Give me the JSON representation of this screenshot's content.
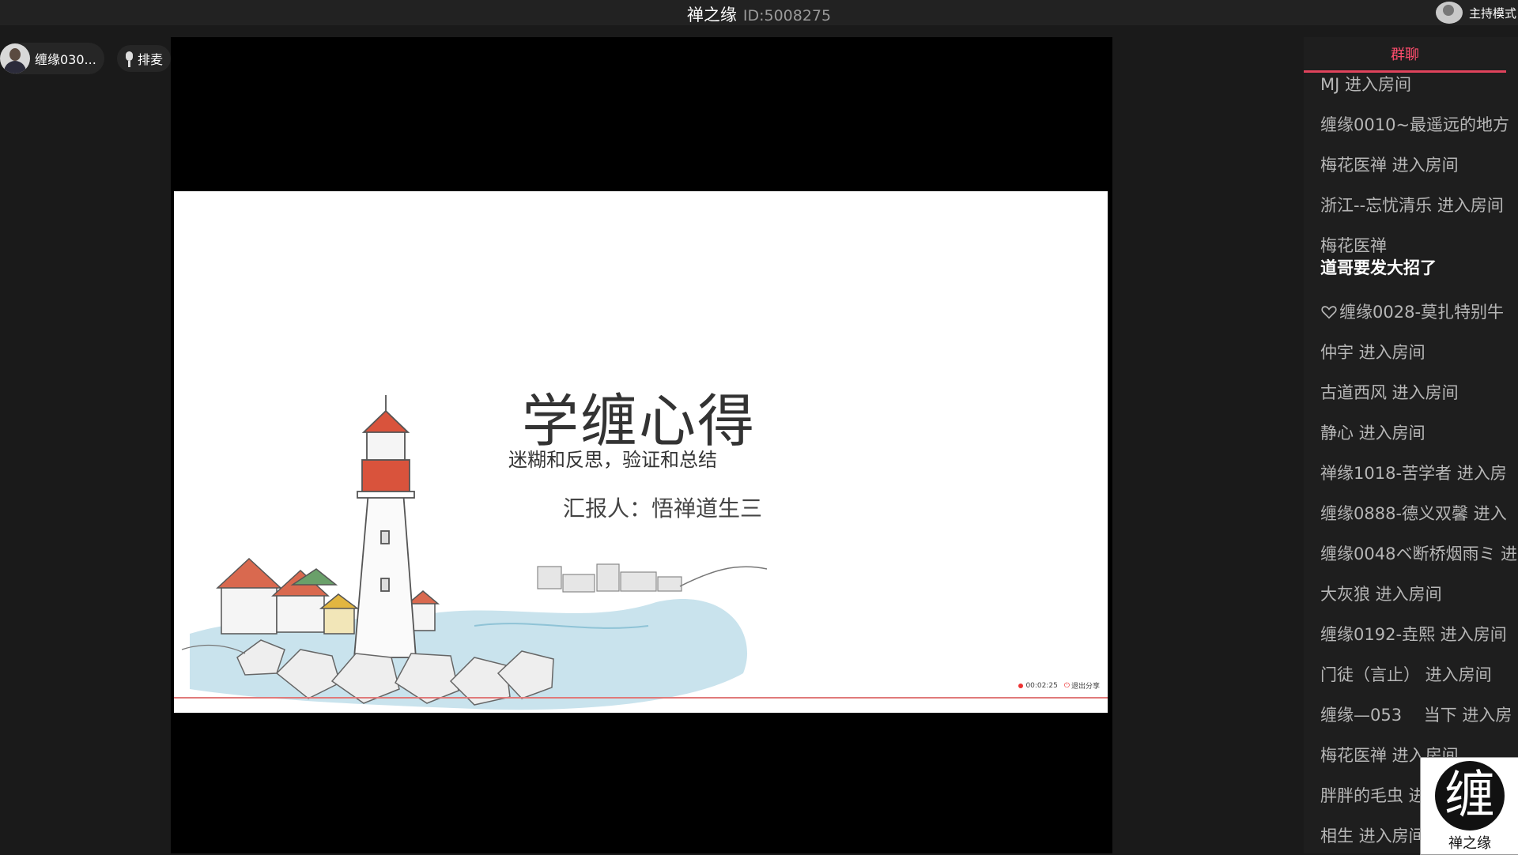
{
  "header": {
    "room_name": "禅之缘",
    "room_id": "ID:5008275",
    "host_mode_label": "主持模式"
  },
  "participants": {
    "user_name": "缠缘030...",
    "queue_label": "排麦"
  },
  "slide": {
    "title": "学缠心得",
    "subtitle": "迷糊和反思，验证和总结",
    "reporter": "汇报人：悟禅道生三",
    "rec_time": "00:02:25",
    "exit_share": "退出分享"
  },
  "chat": {
    "tab_label": "群聊",
    "messages": [
      {
        "text": "MJ 进入房间"
      },
      {
        "text": "缠缘0010~最遥远的地方"
      },
      {
        "text": "梅花医禅 进入房间"
      },
      {
        "text": "浙江--忘忧清乐 进入房间"
      },
      {
        "text": "梅花医禅",
        "content": "道哥要发大招了"
      },
      {
        "text": "缠缘0028-莫扎特别牛",
        "icon": "heart-icon"
      },
      {
        "text": "仲宇 进入房间"
      },
      {
        "text": "古道西风 进入房间"
      },
      {
        "text": "静心 进入房间"
      },
      {
        "text": "禅缘1018-苦学者 进入房"
      },
      {
        "text": "缠缘0888-德义双馨 进入"
      },
      {
        "text": "缠缘0048ベ断桥烟雨ミ 进"
      },
      {
        "text": "大灰狼 进入房间"
      },
      {
        "text": "缠缘0192-垚熙 进入房间"
      },
      {
        "text": "门徒（言止） 进入房间"
      },
      {
        "text": "缠缘—053　 当下 进入房"
      },
      {
        "text": "梅花医禅 进入房间"
      },
      {
        "text": "胖胖的毛虫 进入房间"
      },
      {
        "text": "相生 进入房间"
      }
    ]
  },
  "logo": {
    "mark": "缠",
    "label": "禅之缘"
  }
}
